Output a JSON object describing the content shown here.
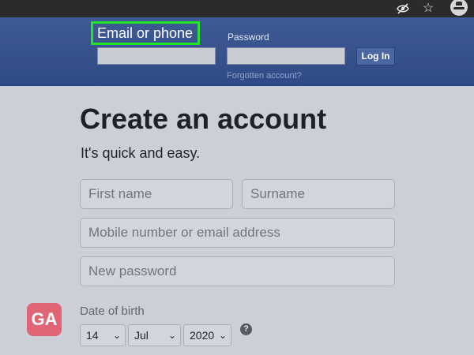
{
  "browser": {
    "icons": [
      "eye-off-icon",
      "star-icon",
      "incognito-icon"
    ]
  },
  "header": {
    "email_label": "Email or phone",
    "password_label": "Password",
    "login_button": "Log In",
    "forgot_link": "Forgotten account?",
    "highlight_color": "#22e52a",
    "bar_color": "#3b5998"
  },
  "signup": {
    "title": "Create an account",
    "subtitle": "It's quick and easy.",
    "first_name_placeholder": "First name",
    "surname_placeholder": "Surname",
    "mobile_placeholder": "Mobile number or email address",
    "password_placeholder": "New password",
    "dob_label": "Date of birth",
    "dob_day": "14",
    "dob_month": "Jul",
    "dob_year": "2020",
    "help_glyph": "?"
  },
  "watermark": {
    "logo_text": "GA",
    "logo_color": "#e06575"
  }
}
